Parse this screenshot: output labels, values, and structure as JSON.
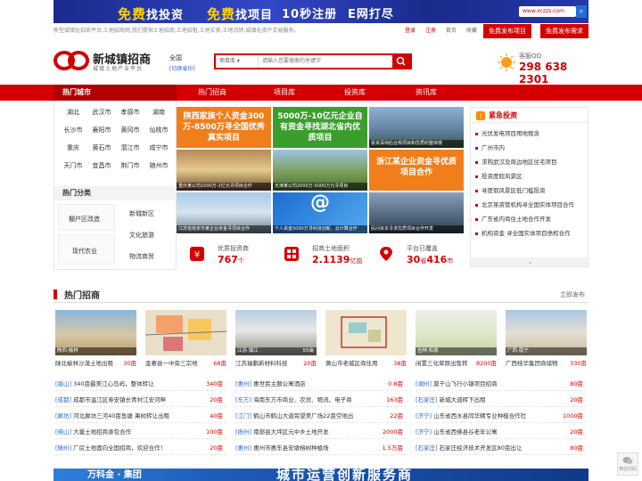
{
  "banner": {
    "seg1_a": "免费",
    "seg1_b": "找投资",
    "seg2_a": "免费",
    "seg2_b": "找项目",
    "seg3": "10秒注册",
    "seg4": "E网打尽",
    "url": "www.xczzs.com"
  },
  "topbar": {
    "intro": "新型城镇化招商平台,土地招商网,我们提供土地招商,土地招租,土地买卖,土地流转,城镇化资产交易服务。",
    "login": "登录",
    "register": "注册",
    "home": "首页",
    "favorite": "收藏",
    "publish_project": "免费发布项目",
    "publish_demand": "免费发布需求"
  },
  "header": {
    "logo": "新城镇招商",
    "logo_sub": "城镇土地产业平台",
    "city": "全国",
    "switch_city": "[切换省份]",
    "search_type": "项目库",
    "search_placeholder": "请输入您要搜索的关键字",
    "qq_label": "客服QQ",
    "qq_number": "298 638 2301"
  },
  "nav": {
    "hot_city": "热门城市",
    "items": [
      "热门招商",
      "项目库",
      "投资库",
      "资讯库"
    ]
  },
  "cities": [
    "湖北",
    "武汉市",
    "孝感市",
    "湖南",
    "长沙市",
    "襄阳市",
    "黄冈市",
    "仙桃市",
    "重庆",
    "黄石市",
    "潜江市",
    "咸宁市",
    "天门市",
    "宜昌市",
    "荆门市",
    "随州市"
  ],
  "categories": {
    "title": "热门分类",
    "items": [
      "棚户区改造",
      "新城新区",
      "文化旅游",
      "现代农业",
      "物流商贸"
    ]
  },
  "tiles": [
    {
      "big": "陕西家族个人资金300万-8500万寻全国优秀真实项目",
      "cap": ""
    },
    {
      "big": "5000万-10亿元企业自有资金寻找湖北省内优质项目",
      "cap": ""
    },
    {
      "big": "",
      "cap": "投资深圳后合规项目和优质的整体楼"
    },
    {
      "big": "",
      "cap": "重庆某公司1000万-2亿元寻项目合作"
    },
    {
      "big": "",
      "cap": "天津某公司2000万-5000万元寻项目"
    },
    {
      "big": "浙江某企业资金寻优质项目合作",
      "cap": ""
    },
    {
      "big": "",
      "cap": "江苏省南京市某企业资金寻项目合作"
    },
    {
      "big": "",
      "cap": "个人资金5000万寻科技创新、云计算合作"
    },
    {
      "big": "",
      "cap": "民间资本寻求优质项目合作开发"
    }
  ],
  "stats": [
    {
      "label": "优质投资商",
      "value": "767",
      "unit": "个"
    },
    {
      "label": "招商土地面积",
      "value": "2.1139",
      "unit": "亿亩"
    },
    {
      "label": "平台已覆盖",
      "value": "30",
      "unit1": "省",
      "value2": "416",
      "unit2": "市"
    }
  ],
  "urgent": {
    "title": "紧急投资",
    "items": [
      "光伏发电项目用地租赁",
      "广州市内",
      "求购武汉及周边地区住宅项目",
      "投资度假风景区",
      "寻度假风景区低门槛投资",
      "北京某资管机构寻全国实体项目合作",
      "广东省内商住土地合作开发",
      "机构资金 寻全国实体项目债权合作"
    ],
    "more": "⌄"
  },
  "section": {
    "title": "热门招商",
    "publish": "立即发布"
  },
  "products": [
    {
      "loc": "陕西·榆林",
      "area": "",
      "name": "陕北榆林沙漠土地出租",
      "size": "30亩"
    },
    {
      "loc": "",
      "area": "",
      "name": "金寨县一中旁三宗地",
      "size": "68亩"
    },
    {
      "loc": "江苏·镇江",
      "area": "55亩",
      "name": "江苏瑞鹏新材料科技",
      "size": "20亩"
    },
    {
      "loc": "",
      "area": "",
      "name": "黄山市老城区商住用",
      "size": "38亩"
    },
    {
      "loc": "吉林·松原",
      "area": "",
      "name": "闲置三化草原出售转",
      "size": "8200亩"
    },
    {
      "loc": "广西·南宁",
      "area": "",
      "name": "广西桂华集团商储物",
      "size": "330亩"
    }
  ],
  "lists": [
    [
      {
        "region": "[眉山]",
        "text": "340亩最美江心岛屿，整体转让",
        "value": "340亩"
      },
      {
        "region": "[成都]",
        "text": "成都市温江区寿安镇长青村江安河畔",
        "value": "20亩"
      },
      {
        "region": "[廊坊]",
        "text": "河北廊坊三河40亩鱼塘 果树转让出租",
        "value": "40亩"
      },
      {
        "region": "[佛山]",
        "text": "大量土地招商承包合作",
        "value": "100亩"
      },
      {
        "region": "[随州]",
        "text": "厂房土地面向全国招商，欢迎合作！",
        "value": "20亩"
      }
    ],
    [
      {
        "region": "[惠州]",
        "text": "惠世民主题公寓酒店",
        "value": "0.8亩"
      },
      {
        "region": "[东方]",
        "text": "海南东方市商业、农贸、物流、电子商",
        "value": "163亩"
      },
      {
        "region": "[江门]",
        "text": "鹤山市鹤山大道旁望美厂场22亩空地出",
        "value": "22亩"
      },
      {
        "region": "[扬州]",
        "text": "南部县大坪区元中乡土地开发",
        "value": "2000亩"
      },
      {
        "region": "[惠州]",
        "text": "惠州市惠东县安墩榕树种植场",
        "value": "1.5万亩"
      }
    ],
    [
      {
        "region": "[湖州]",
        "text": "莫干山飞行小镇项目招商",
        "value": "80亩"
      },
      {
        "region": "[石家庄]",
        "text": "新城大道砖下出租",
        "value": "20亩"
      },
      {
        "region": "[济宁]",
        "text": "山东省西水县同华精专业种植合作社",
        "value": "1000亩"
      },
      {
        "region": "[济宁]",
        "text": "山东省西佛县谷老年公寓",
        "value": "20亩"
      },
      {
        "region": "[石家庄]",
        "text": "石家庄经济技术开发区80亩出让",
        "value": "80亩"
      }
    ]
  ],
  "bottom": {
    "left": "万科金 · 集团",
    "right": "城市运营创新服务商"
  },
  "wechat": "微信扫码"
}
